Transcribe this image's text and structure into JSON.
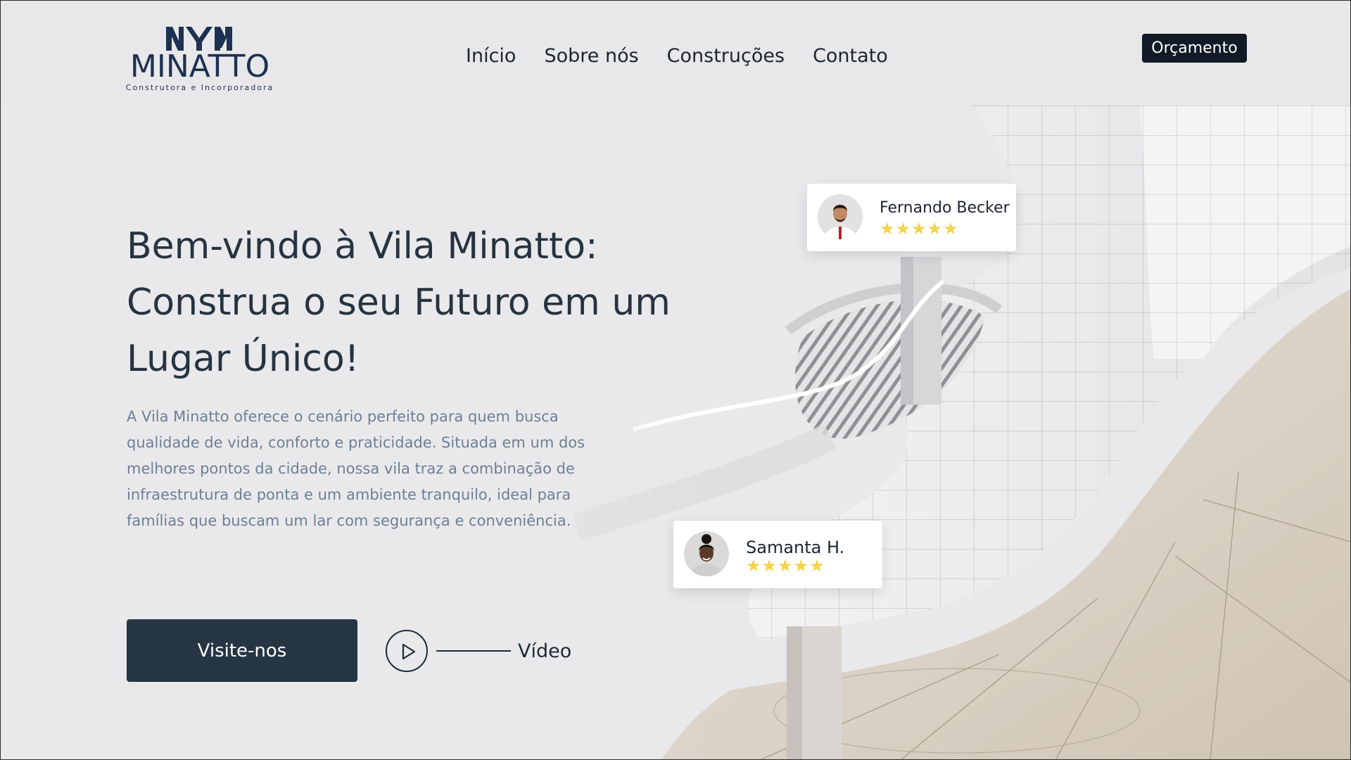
{
  "brand": {
    "name": "MINATTO",
    "tagline": "Construtora e Incorporadora",
    "color": "#1d3150"
  },
  "nav": {
    "items": [
      {
        "label": "Início"
      },
      {
        "label": "Sobre nós"
      },
      {
        "label": "Construções"
      },
      {
        "label": "Contato"
      }
    ]
  },
  "header": {
    "cta_label": "Orçamento"
  },
  "hero": {
    "title_lines": [
      "Bem-vindo à Vila Minatto:",
      "Construa o seu Futuro em um",
      "Lugar Único!"
    ],
    "description": "A Vila Minatto oferece o cenário perfeito para quem busca qualidade de vida, conforto e praticidade. Situada em um dos melhores pontos da cidade, nossa vila traz a combinação de infraestrutura de ponta e um ambiente tranquilo, ideal para famílias que buscam um lar com segurança e conveniência.",
    "visit_label": "Visite-nos",
    "video_label": "Vídeo"
  },
  "reviews": [
    {
      "name": "Fernando Becker",
      "stars": "★★★★★",
      "rating": 5
    },
    {
      "name": "Samanta H.",
      "stars": "★★★★★",
      "rating": 5
    }
  ],
  "colors": {
    "primary_dark": "#263544",
    "header_button": "#111a26",
    "text_muted": "#6d7f96",
    "star": "#f2d34a",
    "background": "#e9e9eb"
  }
}
